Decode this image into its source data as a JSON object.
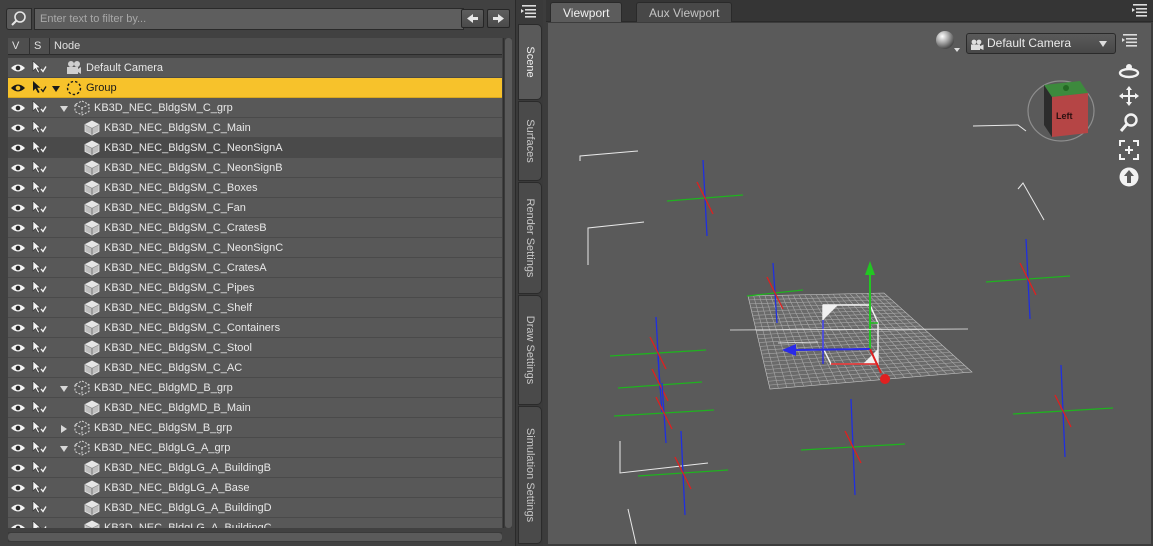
{
  "scene_pane": {
    "filter_placeholder": "Enter text to filter by...",
    "columns": {
      "visible": "V",
      "selectable": "S",
      "node": "Node"
    },
    "rows": [
      {
        "label": "Default Camera",
        "indent": 0,
        "type": "camera",
        "arrow": "none"
      },
      {
        "label": "Group",
        "indent": 0,
        "type": "group",
        "arrow": "down",
        "selected": true
      },
      {
        "label": "KB3D_NEC_BldgSM_C_grp",
        "indent": 1,
        "type": "grp",
        "arrow": "down"
      },
      {
        "label": "KB3D_NEC_BldgSM_C_Main",
        "indent": 2,
        "type": "mesh",
        "arrow": "none"
      },
      {
        "label": "KB3D_NEC_BldgSM_C_NeonSignA",
        "indent": 2,
        "type": "mesh",
        "arrow": "none",
        "hover": true
      },
      {
        "label": "KB3D_NEC_BldgSM_C_NeonSignB",
        "indent": 2,
        "type": "mesh",
        "arrow": "none"
      },
      {
        "label": "KB3D_NEC_BldgSM_C_Boxes",
        "indent": 2,
        "type": "mesh",
        "arrow": "none"
      },
      {
        "label": "KB3D_NEC_BldgSM_C_Fan",
        "indent": 2,
        "type": "mesh",
        "arrow": "none"
      },
      {
        "label": "KB3D_NEC_BldgSM_C_CratesB",
        "indent": 2,
        "type": "mesh",
        "arrow": "none"
      },
      {
        "label": "KB3D_NEC_BldgSM_C_NeonSignC",
        "indent": 2,
        "type": "mesh",
        "arrow": "none"
      },
      {
        "label": "KB3D_NEC_BldgSM_C_CratesA",
        "indent": 2,
        "type": "mesh",
        "arrow": "none"
      },
      {
        "label": "KB3D_NEC_BldgSM_C_Pipes",
        "indent": 2,
        "type": "mesh",
        "arrow": "none"
      },
      {
        "label": "KB3D_NEC_BldgSM_C_Shelf",
        "indent": 2,
        "type": "mesh",
        "arrow": "none"
      },
      {
        "label": "KB3D_NEC_BldgSM_C_Containers",
        "indent": 2,
        "type": "mesh",
        "arrow": "none"
      },
      {
        "label": "KB3D_NEC_BldgSM_C_Stool",
        "indent": 2,
        "type": "mesh",
        "arrow": "none"
      },
      {
        "label": "KB3D_NEC_BldgSM_C_AC",
        "indent": 2,
        "type": "mesh",
        "arrow": "none"
      },
      {
        "label": "KB3D_NEC_BldgMD_B_grp",
        "indent": 1,
        "type": "grp",
        "arrow": "down"
      },
      {
        "label": "KB3D_NEC_BldgMD_B_Main",
        "indent": 2,
        "type": "mesh",
        "arrow": "none"
      },
      {
        "label": "KB3D_NEC_BldgSM_B_grp",
        "indent": 1,
        "type": "grp",
        "arrow": "right"
      },
      {
        "label": "KB3D_NEC_BldgLG_A_grp",
        "indent": 1,
        "type": "grp",
        "arrow": "down"
      },
      {
        "label": "KB3D_NEC_BldgLG_A_BuildingB",
        "indent": 2,
        "type": "mesh",
        "arrow": "none"
      },
      {
        "label": "KB3D_NEC_BldgLG_A_Base",
        "indent": 2,
        "type": "mesh",
        "arrow": "none"
      },
      {
        "label": "KB3D_NEC_BldgLG_A_BuildingD",
        "indent": 2,
        "type": "mesh",
        "arrow": "none"
      },
      {
        "label": "KB3D_NEC_BldgLG_A_BuildingC",
        "indent": 2,
        "type": "mesh",
        "arrow": "none"
      }
    ]
  },
  "side_tabs": [
    {
      "label": "Scene",
      "active": true
    },
    {
      "label": "Surfaces",
      "active": false
    },
    {
      "label": "Render Settings",
      "active": false
    },
    {
      "label": "Draw Settings",
      "active": false
    },
    {
      "label": "Simulation Settings",
      "active": false
    }
  ],
  "viewport": {
    "tabs": [
      {
        "label": "Viewport",
        "active": true
      },
      {
        "label": "Aux Viewport",
        "active": false
      }
    ],
    "camera_select": "Default Camera",
    "view_cube_label": "Left"
  },
  "colors": {
    "selected_row": "#f7c22b",
    "axis_x": "#e02020",
    "axis_y": "#1fb31f",
    "axis_z": "#1f2fe0",
    "grid": "#a9a9a9"
  },
  "icons": [
    "search-icon",
    "arrow-left-icon",
    "arrow-right-icon",
    "eye-icon",
    "select-arrow-icon",
    "camera-icon",
    "group-icon",
    "grp-icon",
    "mesh-icon",
    "pane-menu-icon",
    "sphere-icon",
    "orbit-icon",
    "pan-icon",
    "zoom-icon",
    "frame-icon",
    "reset-icon"
  ]
}
